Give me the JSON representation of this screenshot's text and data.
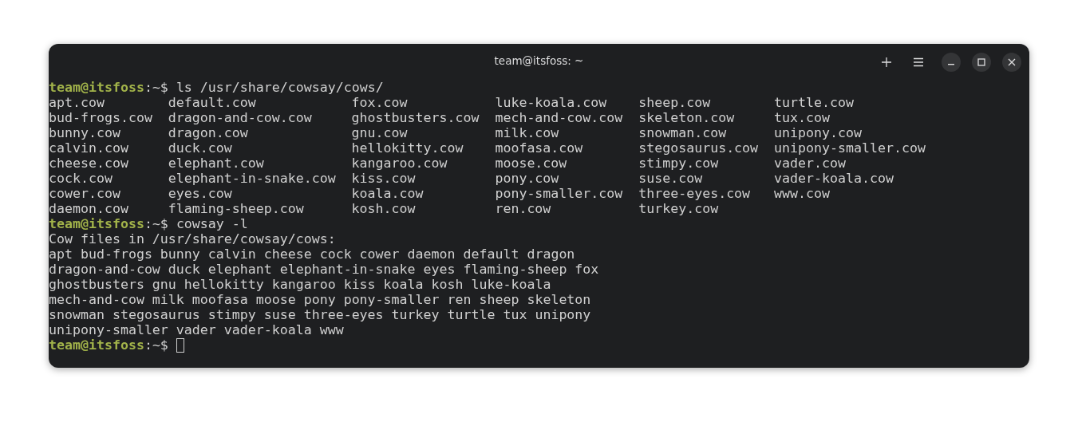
{
  "window": {
    "title": "team@itsfoss: ~"
  },
  "header_buttons": [
    {
      "kind": "new-tab"
    },
    {
      "kind": "menu"
    },
    {
      "kind": "minimize"
    },
    {
      "kind": "maximize"
    },
    {
      "kind": "close"
    }
  ],
  "lines": [
    {
      "kind": "prompt",
      "user_host": "team@itsfoss",
      "path": ":~$",
      "command": "ls /usr/share/cowsay/cows/",
      "cursor": false
    },
    {
      "kind": "grid",
      "cells": [
        "apt.cow",
        "default.cow",
        "fox.cow",
        "luke-koala.cow",
        "sheep.cow",
        "turtle.cow"
      ]
    },
    {
      "kind": "grid",
      "cells": [
        "bud-frogs.cow",
        "dragon-and-cow.cow",
        "ghostbusters.cow",
        "mech-and-cow.cow",
        "skeleton.cow",
        "tux.cow"
      ]
    },
    {
      "kind": "grid",
      "cells": [
        "bunny.cow",
        "dragon.cow",
        "gnu.cow",
        "milk.cow",
        "snowman.cow",
        "unipony.cow"
      ]
    },
    {
      "kind": "grid",
      "cells": [
        "calvin.cow",
        "duck.cow",
        "hellokitty.cow",
        "moofasa.cow",
        "stegosaurus.cow",
        "unipony-smaller.cow"
      ]
    },
    {
      "kind": "grid",
      "cells": [
        "cheese.cow",
        "elephant.cow",
        "kangaroo.cow",
        "moose.cow",
        "stimpy.cow",
        "vader.cow"
      ]
    },
    {
      "kind": "grid",
      "cells": [
        "cock.cow",
        "elephant-in-snake.cow",
        "kiss.cow",
        "pony.cow",
        "suse.cow",
        "vader-koala.cow"
      ]
    },
    {
      "kind": "grid",
      "cells": [
        "cower.cow",
        "eyes.cow",
        "koala.cow",
        "pony-smaller.cow",
        "three-eyes.cow",
        "www.cow"
      ]
    },
    {
      "kind": "grid",
      "cells": [
        "daemon.cow",
        "flaming-sheep.cow",
        "kosh.cow",
        "ren.cow",
        "turkey.cow"
      ]
    },
    {
      "kind": "prompt",
      "user_host": "team@itsfoss",
      "path": ":~$",
      "command": "cowsay -l",
      "cursor": false
    },
    {
      "kind": "output",
      "text": "Cow files in /usr/share/cowsay/cows:"
    },
    {
      "kind": "output",
      "text": "apt bud-frogs bunny calvin cheese cock cower daemon default dragon"
    },
    {
      "kind": "output",
      "text": "dragon-and-cow duck elephant elephant-in-snake eyes flaming-sheep fox"
    },
    {
      "kind": "output",
      "text": "ghostbusters gnu hellokitty kangaroo kiss koala kosh luke-koala"
    },
    {
      "kind": "output",
      "text": "mech-and-cow milk moofasa moose pony pony-smaller ren sheep skeleton"
    },
    {
      "kind": "output",
      "text": "snowman stegosaurus stimpy suse three-eyes turkey turtle tux unipony"
    },
    {
      "kind": "output",
      "text": "unipony-smaller vader vader-koala www"
    },
    {
      "kind": "prompt",
      "user_host": "team@itsfoss",
      "path": ":~$",
      "cursor": true
    }
  ]
}
